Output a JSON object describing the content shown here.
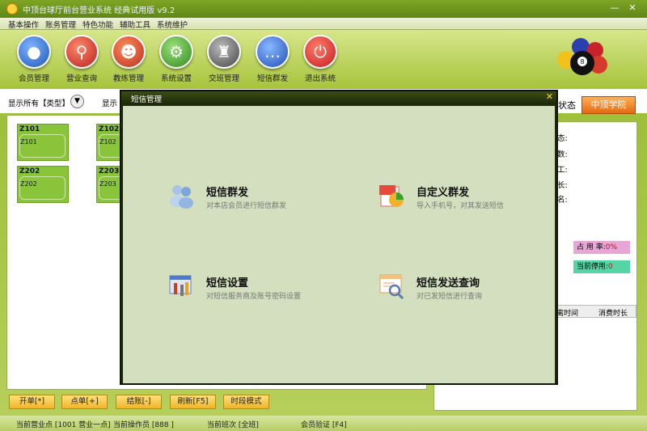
{
  "window": {
    "title": "中顶台球厅前台营业系统 经典试用版 v9.2"
  },
  "menu": [
    "基本操作",
    "账务管理",
    "特色功能",
    "辅助工具",
    "系统维护"
  ],
  "toolbar": [
    {
      "label": "会员管理",
      "icon": "member-icon",
      "color": "#2a6fd1"
    },
    {
      "label": "营业查询",
      "icon": "search-icon",
      "color": "#d33b2a"
    },
    {
      "label": "教练管理",
      "icon": "coach-icon",
      "color": "#d14a2a"
    },
    {
      "label": "系统设置",
      "icon": "gear-icon",
      "color": "#3d9a2a"
    },
    {
      "label": "交班管理",
      "icon": "handover-icon",
      "color": "#666666"
    },
    {
      "label": "短信群发",
      "icon": "sms-icon",
      "color": "#2a6fd1"
    },
    {
      "label": "退出系统",
      "icon": "power-icon",
      "color": "#d42a2a"
    }
  ],
  "filter": {
    "show_all_type": "显示所有【类型】",
    "show_prefix": "显示",
    "status_suffix": "状态",
    "brand_button": "中顶学院"
  },
  "tables": [
    {
      "code": "Z101",
      "sub": "Z101"
    },
    {
      "code": "Z102",
      "sub": "Z102"
    },
    {
      "code": "Z202",
      "sub": "Z202"
    },
    {
      "code": "Z203",
      "sub": "Z203"
    }
  ],
  "right_info": {
    "rows": [
      "态:",
      "数:",
      "工:",
      "长:",
      "名:"
    ],
    "occupancy_label": "占 用 率:",
    "occupancy_value": "0%",
    "disabled_label": "当前停用:",
    "disabled_value": "0",
    "col_time": "离时间",
    "col_duration": "消费时长"
  },
  "bottom_buttons": [
    "开单[*]",
    "点单[+]",
    "结账[-]",
    "刷新[F5]",
    "时段模式"
  ],
  "status": {
    "point": "当前营业点 [1001 营业一点]",
    "operator": "当前操作员 [888 ]",
    "shift": "当前班次 [全班]",
    "verify": "会员验证 [F4]"
  },
  "dialog": {
    "title": "短信管理",
    "items": [
      {
        "title": "短信群发",
        "desc": "对本店会员进行短信群发",
        "icon": "users-icon"
      },
      {
        "title": "自定义群发",
        "desc": "导入手机号，对其发送短信",
        "icon": "chart-icon"
      },
      {
        "title": "短信设置",
        "desc": "对短信服务商及账号密码设置",
        "icon": "settings-tools-icon"
      },
      {
        "title": "短信发送查询",
        "desc": "对已发短信进行查询",
        "icon": "document-search-icon"
      }
    ]
  }
}
